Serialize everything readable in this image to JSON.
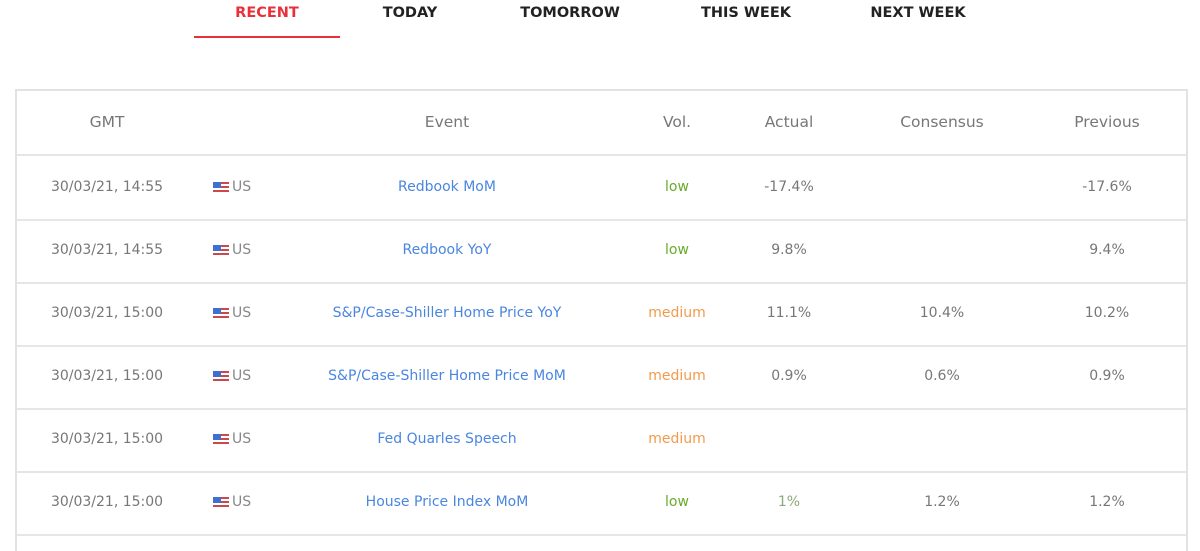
{
  "tabs": [
    {
      "label": "RECENT",
      "active": true
    },
    {
      "label": "TODAY",
      "active": false
    },
    {
      "label": "TOMORROW",
      "active": false
    },
    {
      "label": "THIS WEEK",
      "active": false
    },
    {
      "label": "NEXT WEEK",
      "active": false
    }
  ],
  "colors": {
    "accent": "#e8303a",
    "link": "#4a86e0",
    "vol_low": "#6aaa2c",
    "vol_medium": "#f29a4a"
  },
  "table": {
    "headers": {
      "gmt": "GMT",
      "event": "Event",
      "vol": "Vol.",
      "actual": "Actual",
      "consensus": "Consensus",
      "previous": "Previous"
    },
    "rows": [
      {
        "gmt": "30/03/21, 14:55",
        "flag_icon": "us-flag-icon",
        "country": "US",
        "event": "Redbook MoM",
        "vol": "low",
        "actual": "-17.4%",
        "consensus": "",
        "previous": "-17.6%"
      },
      {
        "gmt": "30/03/21, 14:55",
        "flag_icon": "us-flag-icon",
        "country": "US",
        "event": "Redbook YoY",
        "vol": "low",
        "actual": "9.8%",
        "consensus": "",
        "previous": "9.4%"
      },
      {
        "gmt": "30/03/21, 15:00",
        "flag_icon": "us-flag-icon",
        "country": "US",
        "event": "S&P/Case-Shiller Home Price YoY",
        "vol": "medium",
        "actual": "11.1%",
        "consensus": "10.4%",
        "previous": "10.2%"
      },
      {
        "gmt": "30/03/21, 15:00",
        "flag_icon": "us-flag-icon",
        "country": "US",
        "event": "S&P/Case-Shiller Home Price MoM",
        "vol": "medium",
        "actual": "0.9%",
        "consensus": "0.6%",
        "previous": "0.9%"
      },
      {
        "gmt": "30/03/21, 15:00",
        "flag_icon": "us-flag-icon",
        "country": "US",
        "event": "Fed Quarles Speech",
        "vol": "medium",
        "actual": "",
        "consensus": "",
        "previous": ""
      },
      {
        "gmt": "30/03/21, 15:00",
        "flag_icon": "us-flag-icon",
        "country": "US",
        "event": "House Price Index MoM",
        "vol": "low",
        "actual": "1%",
        "consensus": "1.2%",
        "previous": "1.2%"
      }
    ]
  }
}
